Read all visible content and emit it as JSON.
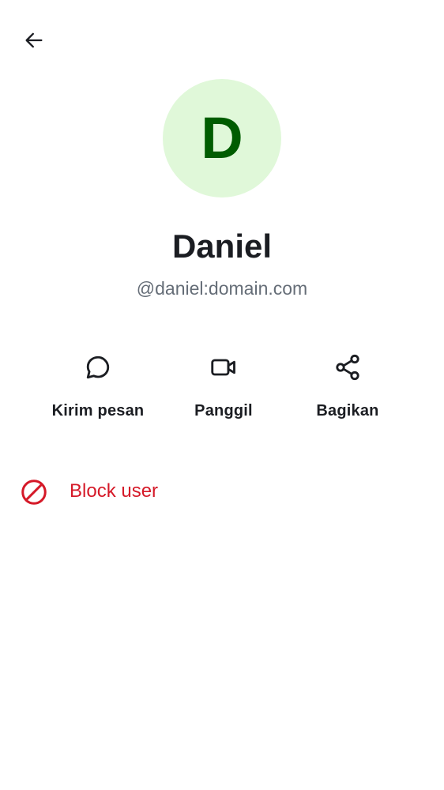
{
  "header": {
    "back_icon": "arrow-left-icon"
  },
  "profile": {
    "avatar_letter": "D",
    "avatar_bg": "#e0f8d9",
    "avatar_fg": "#005c00",
    "display_name": "Daniel",
    "user_id": "@daniel:domain.com"
  },
  "actions": [
    {
      "icon": "chat-bubble-icon",
      "label": "Kirim pesan"
    },
    {
      "icon": "video-camera-icon",
      "label": "Panggil"
    },
    {
      "icon": "share-icon",
      "label": "Bagikan"
    }
  ],
  "block": {
    "icon": "block-icon",
    "label": "Block user",
    "color": "#d51928"
  }
}
